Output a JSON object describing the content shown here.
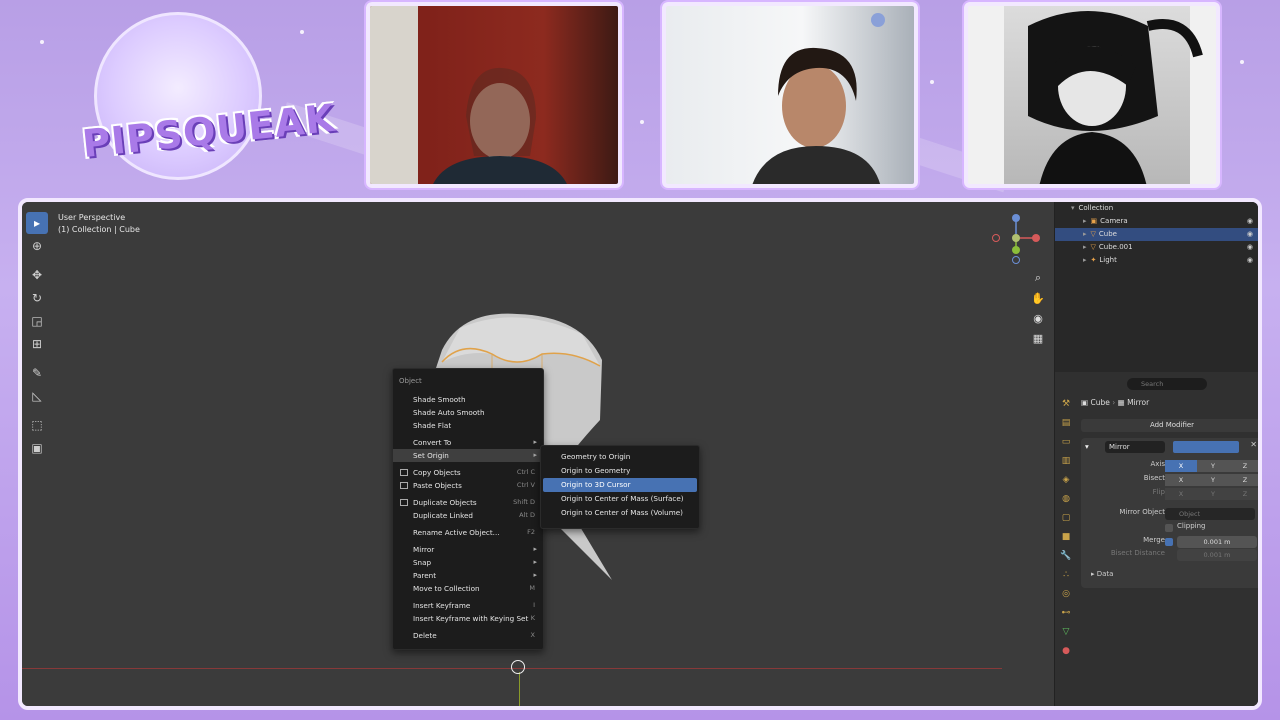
{
  "logo": {
    "text": "PIPSQUEAK"
  },
  "cams": [
    {
      "label": ""
    },
    {
      "label": ""
    },
    {
      "label": ""
    }
  ],
  "viewport": {
    "view_name": "User Perspective",
    "collection_line": "(1) Collection | Cube"
  },
  "context_menu": {
    "title": "Object",
    "items": [
      {
        "label": "Shade Smooth",
        "shortcut": ""
      },
      {
        "label": "Shade Auto Smooth",
        "shortcut": ""
      },
      {
        "label": "Shade Flat",
        "shortcut": ""
      },
      {
        "label": "Convert To",
        "shortcut": ""
      },
      {
        "label": "Set Origin",
        "shortcut": ""
      },
      {
        "label": "Copy Objects",
        "shortcut": "Ctrl C"
      },
      {
        "label": "Paste Objects",
        "shortcut": "Ctrl V"
      },
      {
        "label": "Duplicate Objects",
        "shortcut": "Shift D"
      },
      {
        "label": "Duplicate Linked",
        "shortcut": "Alt D"
      },
      {
        "label": "Rename Active Object...",
        "shortcut": "F2"
      },
      {
        "label": "Mirror",
        "shortcut": ""
      },
      {
        "label": "Snap",
        "shortcut": ""
      },
      {
        "label": "Parent",
        "shortcut": ""
      },
      {
        "label": "Move to Collection",
        "shortcut": "M"
      },
      {
        "label": "Insert Keyframe",
        "shortcut": "I"
      },
      {
        "label": "Insert Keyframe with Keying Set",
        "shortcut": "K"
      },
      {
        "label": "Delete",
        "shortcut": "X"
      }
    ]
  },
  "set_origin_submenu": {
    "items": [
      "Geometry to Origin",
      "Origin to Geometry",
      "Origin to 3D Cursor",
      "Origin to Center of Mass (Surface)",
      "Origin to Center of Mass (Volume)"
    ],
    "highlighted": "Origin to 3D Cursor"
  },
  "outliner": {
    "rows": [
      {
        "label": "Collection"
      },
      {
        "label": "Camera"
      },
      {
        "label": "Cube",
        "selected": true
      },
      {
        "label": "Cube.001"
      },
      {
        "label": "Light"
      }
    ]
  },
  "properties": {
    "search_placeholder": "Search",
    "object_name": "Cube",
    "modifier_breadcrumb": "Mirror",
    "add_modifier": "Add Modifier",
    "modifier_name": "Mirror",
    "axis_label": "Axis",
    "bisect_label": "Bisect",
    "flip_label": "Flip",
    "x": "X",
    "y": "Y",
    "z": "Z",
    "mirror_object_label": "Mirror Object",
    "mirror_object_placeholder": "Object",
    "clipping_label": "Clipping",
    "merge_label": "Merge",
    "merge_value": "0.001 m",
    "bisect_distance_label": "Bisect Distance",
    "bisect_distance_value": "0.001 m",
    "data_label": "Data"
  },
  "colors": {
    "accent_blue": "#4772b3",
    "background_purple": "#b89fe6",
    "object_orange": "#e7a24a"
  }
}
